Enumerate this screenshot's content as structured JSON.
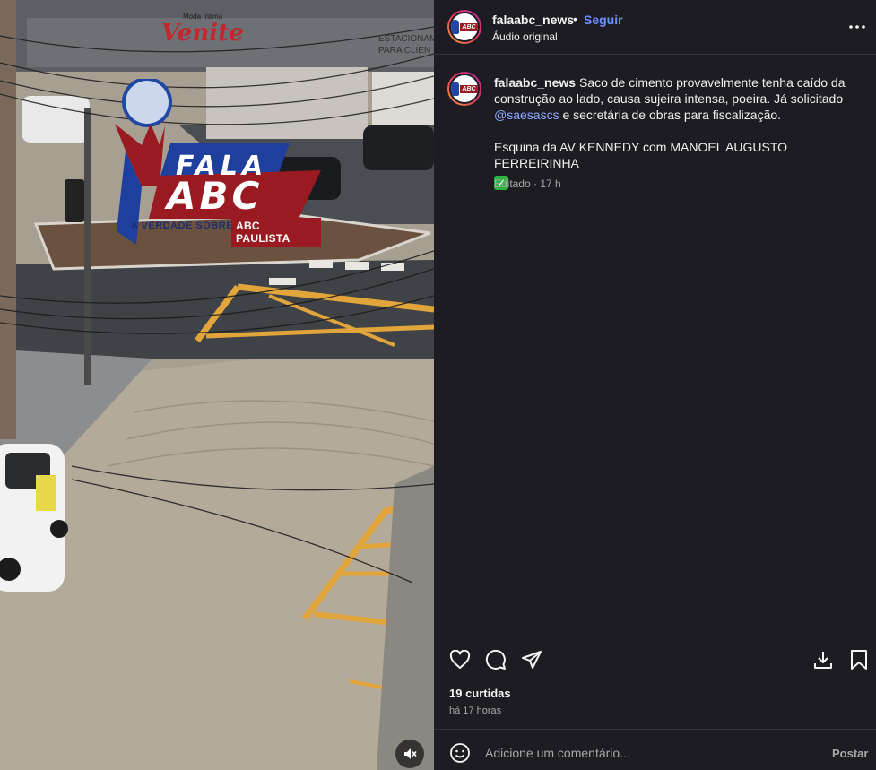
{
  "media": {
    "store_sign": "Venite",
    "store_sub": "Moda íntima",
    "parking_sign_1": "ESTACIONAM",
    "parking_sign_2": "PARA CLIEN",
    "logo_fala": "FALA",
    "logo_abc": "ABC",
    "logo_tagline": "A VERDADE SOBRE",
    "logo_region": "ABC PAULISTA",
    "mute_icon": "speaker-muted-icon"
  },
  "header": {
    "username": "falaabc_news",
    "separator": "•",
    "follow_label": "Seguir",
    "audio_label": "Áudio original",
    "avatar_text": "ABC"
  },
  "caption": {
    "username": "falaabc_news",
    "text_1": "Saco de cimento provavelmente tenha caído da construção ao lado, causa sujeira intensa, poeira. Já solicitado",
    "mention": "@saesascs",
    "text_2": "e secretária de obras para fiscalização.",
    "text_3": "Esquina da AV KENNEDY com MANOEL AUGUSTO FERREIRINHA",
    "check_emoji": "✓",
    "meta": "Editado · 17 h"
  },
  "actions": {
    "like_icon": "heart-icon",
    "comment_icon": "comment-icon",
    "share_icon": "send-icon",
    "download_icon": "download-icon",
    "save_icon": "bookmark-icon"
  },
  "stats": {
    "likes": "19 curtidas",
    "time": "há 17 horas"
  },
  "comment": {
    "placeholder": "Adicione um comentário...",
    "post_label": "Postar"
  },
  "colors": {
    "panel_bg": "#1c1c22",
    "link_blue": "#6e8eff",
    "mention_blue": "#8ea7ff",
    "muted_text": "#a8a8a8"
  }
}
